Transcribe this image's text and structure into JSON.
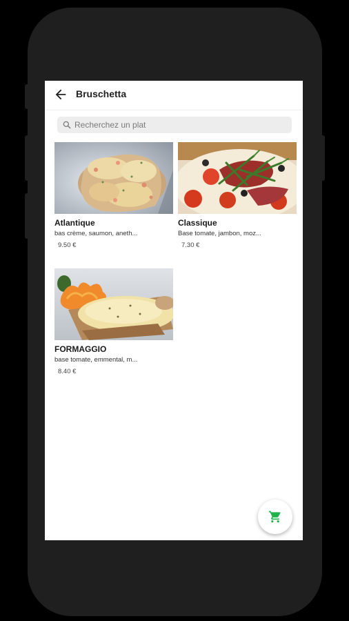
{
  "header": {
    "title": "Bruschetta",
    "back_icon": "arrow-left-icon"
  },
  "search": {
    "placeholder": "Recherchez un plat",
    "value": "",
    "icon": "search-icon"
  },
  "products": [
    {
      "name": "Atlantique",
      "description": "bas crème, saumon, aneth...",
      "price": "9.50 €"
    },
    {
      "name": "Classique",
      "description": "Base tomate, jambon, moz...",
      "price": "7.30 €"
    },
    {
      "name": "FORMAGGIO",
      "description": "base tomate, emmental, m...",
      "price": "8.40 €"
    }
  ],
  "cart_button": {
    "icon": "shopping-cart-icon",
    "color": "#1fb24a"
  },
  "colors": {
    "background": "#000000",
    "device": "#1f1f1f",
    "search_bg": "#ededed",
    "accent": "#1fb24a"
  }
}
